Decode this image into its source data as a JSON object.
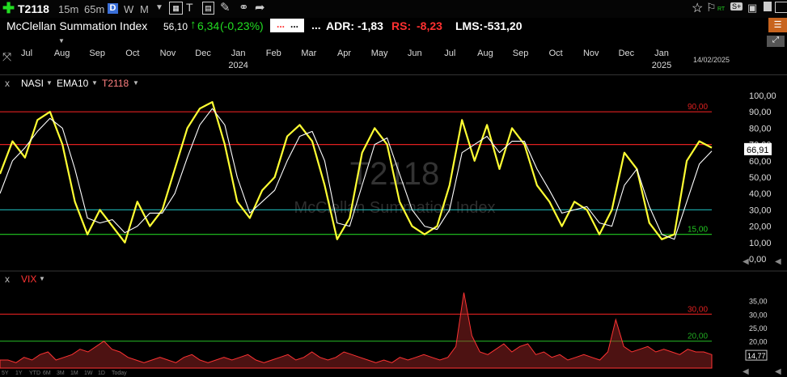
{
  "toolbar": {
    "symbol": "T2118",
    "intervals": [
      "15m",
      "65m",
      "D",
      "W",
      "M"
    ],
    "active_interval": "D",
    "flag_badge": "RT",
    "sr_badge": "S+"
  },
  "infobar": {
    "title": "McClellan Summation Index",
    "price": "56,10",
    "change": "6,34",
    "change_pct": "(-0,23%)",
    "box1": "...",
    "box2": "...",
    "dots": "...",
    "adr_label": "ADR:",
    "adr_value": "-1,83",
    "rs_label": "RS:",
    "rs_value": "-8,23",
    "lms_label": "LMS:",
    "lms_value": "-531,20"
  },
  "time_axis": {
    "months": [
      "Jul",
      "Aug",
      "Sep",
      "Oct",
      "Nov",
      "Dec",
      "Jan",
      "Feb",
      "Mar",
      "Apr",
      "May",
      "Jun",
      "Jul",
      "Aug",
      "Sep",
      "Oct",
      "Nov",
      "Dec",
      "Jan"
    ],
    "years": [
      {
        "label": "2024",
        "month_index": 6
      },
      {
        "label": "2025",
        "month_index": 18
      }
    ],
    "date_label": "14/02/2025"
  },
  "pane1": {
    "close": "x",
    "legend": [
      {
        "name": "NASI",
        "color": "#ffff33"
      },
      {
        "name": "EMA10",
        "color": "#ffffff"
      },
      {
        "name": "T2118",
        "color": "#ff6666"
      }
    ],
    "watermark_symbol": "T2118",
    "watermark_title": "McClellan Summation Index",
    "current_value": "66,91"
  },
  "pane2": {
    "close": "x",
    "legend": [
      {
        "name": "VIX",
        "color": "#ff3333"
      }
    ],
    "current_value": "14,77"
  },
  "bottom_buttons": [
    "5Y",
    "1Y",
    "YTD",
    "6M",
    "3M",
    "1M",
    "1W",
    "1D",
    "Today"
  ],
  "chart_data": [
    {
      "type": "line",
      "name": "NASI pane",
      "ylim": [
        0,
        100
      ],
      "y_ticks": [
        "0,00",
        "10,00",
        "20,00",
        "30,00",
        "40,00",
        "50,00",
        "60,00",
        "70,00",
        "80,00",
        "90,00",
        "100,00"
      ],
      "reference_lines": [
        {
          "value": 90,
          "label": "90,00",
          "color": "#e02020"
        },
        {
          "value": 70,
          "label": "",
          "color": "#e02020"
        },
        {
          "value": 30,
          "label": "",
          "color": "#1aa0a0"
        },
        {
          "value": 15,
          "label": "15,00",
          "color": "#22cc22"
        }
      ],
      "series": [
        {
          "name": "NASI",
          "color": "#ffff33",
          "values": [
            52,
            72,
            62,
            85,
            90,
            70,
            35,
            15,
            30,
            20,
            10,
            35,
            20,
            30,
            55,
            80,
            92,
            96,
            70,
            35,
            25,
            42,
            50,
            75,
            82,
            72,
            45,
            12,
            25,
            65,
            80,
            70,
            35,
            20,
            15,
            20,
            45,
            85,
            60,
            82,
            55,
            80,
            70,
            45,
            35,
            20,
            35,
            30,
            15,
            30,
            65,
            55,
            22,
            12,
            15,
            60,
            72,
            68
          ]
        },
        {
          "name": "EMA10",
          "color": "#ffffff",
          "values": [
            40,
            60,
            68,
            78,
            86,
            80,
            55,
            25,
            22,
            24,
            16,
            20,
            28,
            28,
            40,
            62,
            82,
            92,
            82,
            50,
            28,
            35,
            42,
            60,
            75,
            78,
            60,
            22,
            20,
            45,
            70,
            74,
            52,
            30,
            20,
            18,
            30,
            65,
            70,
            75,
            65,
            72,
            72,
            55,
            42,
            28,
            30,
            32,
            22,
            20,
            45,
            55,
            32,
            15,
            12,
            35,
            58,
            66
          ]
        }
      ]
    },
    {
      "type": "area",
      "name": "VIX",
      "ylim": [
        10,
        40
      ],
      "y_ticks": [
        "15,00",
        "20,00",
        "25,00",
        "30,00",
        "35,00"
      ],
      "reference_lines": [
        {
          "value": 30,
          "label": "30,00",
          "color": "#e02020"
        },
        {
          "value": 20,
          "label": "20,00",
          "color": "#22aa22"
        }
      ],
      "series": [
        {
          "name": "VIX",
          "color": "#ff3333",
          "values": [
            13,
            13,
            12,
            14,
            13,
            15,
            16,
            13,
            14,
            15,
            17,
            16,
            18,
            20,
            17,
            16,
            14,
            13,
            12,
            13,
            14,
            13,
            12,
            14,
            15,
            13,
            12,
            13,
            14,
            13,
            14,
            15,
            13,
            12,
            13,
            14,
            15,
            13,
            14,
            16,
            14,
            13,
            14,
            16,
            15,
            14,
            13,
            12,
            13,
            12,
            14,
            13,
            14,
            15,
            14,
            13,
            14,
            18,
            38,
            22,
            16,
            15,
            17,
            19,
            16,
            18,
            19,
            15,
            16,
            14,
            15,
            13,
            14,
            15,
            14,
            13,
            16,
            28,
            18,
            16,
            17,
            18,
            16,
            17,
            16,
            15,
            17,
            16,
            16,
            15
          ]
        }
      ]
    }
  ]
}
